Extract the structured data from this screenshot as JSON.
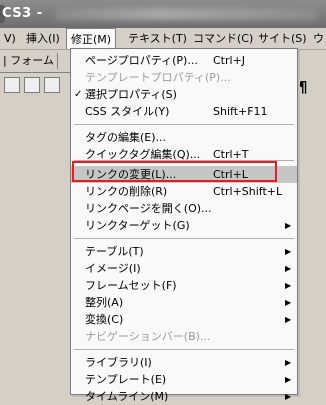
{
  "window": {
    "title": "CS3 -"
  },
  "menubar": {
    "items": [
      {
        "label": "V)"
      },
      {
        "label": "挿入(I)"
      },
      {
        "label": "修正(M)"
      },
      {
        "label": "テキスト(T)"
      },
      {
        "label": "コマンド(C)"
      },
      {
        "label": "サイト(S)"
      },
      {
        "label": "ウ"
      }
    ]
  },
  "toolbar": {
    "tab_label": "| フォーム",
    "pilcrow": "¶"
  },
  "menu": {
    "items": [
      {
        "label": "ページプロパティ(P)...",
        "shortcut": "Ctrl+J"
      },
      {
        "label": "テンプレートプロパティ(P)...",
        "disabled": true
      },
      {
        "label": "選択プロパティ(S)",
        "checked": "✓"
      },
      {
        "label": "CSS スタイル(Y)",
        "shortcut": "Shift+F11"
      },
      {
        "label": "タグの編集(E)..."
      },
      {
        "label": "クイックタグ編集(Q)...",
        "shortcut": "Ctrl+T"
      },
      {
        "label": "リンクの変更(L)...",
        "shortcut": "Ctrl+L",
        "highlighted": true
      },
      {
        "label": "リンクの削除(R)",
        "shortcut": "Ctrl+Shift+L"
      },
      {
        "label": "リンクページを開く(O)..."
      },
      {
        "label": "リンクターゲット(G)",
        "submenu": "▶"
      },
      {
        "label": "テーブル(T)",
        "submenu": "▶"
      },
      {
        "label": "イメージ(I)",
        "submenu": "▶"
      },
      {
        "label": "フレームセット(F)",
        "submenu": "▶"
      },
      {
        "label": "整列(A)",
        "submenu": "▶"
      },
      {
        "label": "変換(C)",
        "submenu": "▶"
      },
      {
        "label": "ナビゲーションバー(B)...",
        "disabled": true
      },
      {
        "label": "ライブラリ(I)",
        "submenu": "▶"
      },
      {
        "label": "テンプレート(E)",
        "submenu": "▶"
      },
      {
        "label": "タイムライン(M)",
        "submenu": "▶"
      }
    ]
  }
}
